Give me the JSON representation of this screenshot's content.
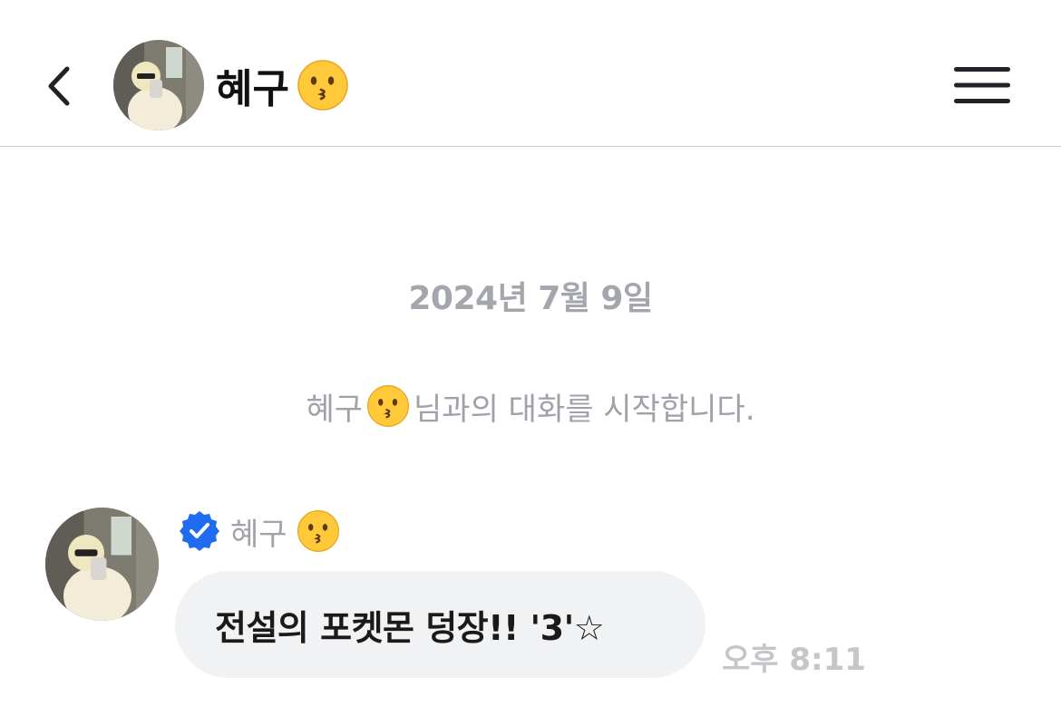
{
  "header": {
    "contact_name": "혜구",
    "emoji_icon": "kissing-face-emoji",
    "back_icon": "chevron-left-icon",
    "menu_icon": "hamburger-menu-icon"
  },
  "conversation": {
    "date": "2024년 7월 9일",
    "start_prefix": "혜구",
    "start_suffix": "님과의 대화를 시작합니다."
  },
  "message": {
    "sender": "혜구",
    "verified_icon": "verified-badge-icon",
    "text": "전설의 포켓몬 덩장!! '3'☆",
    "time": "오후 8:11"
  },
  "colors": {
    "verified_blue": "#1f6cf0",
    "emoji_yellow": "#ffc93a",
    "muted_text": "#a3a6ad",
    "bubble_bg": "#f1f2f4"
  }
}
